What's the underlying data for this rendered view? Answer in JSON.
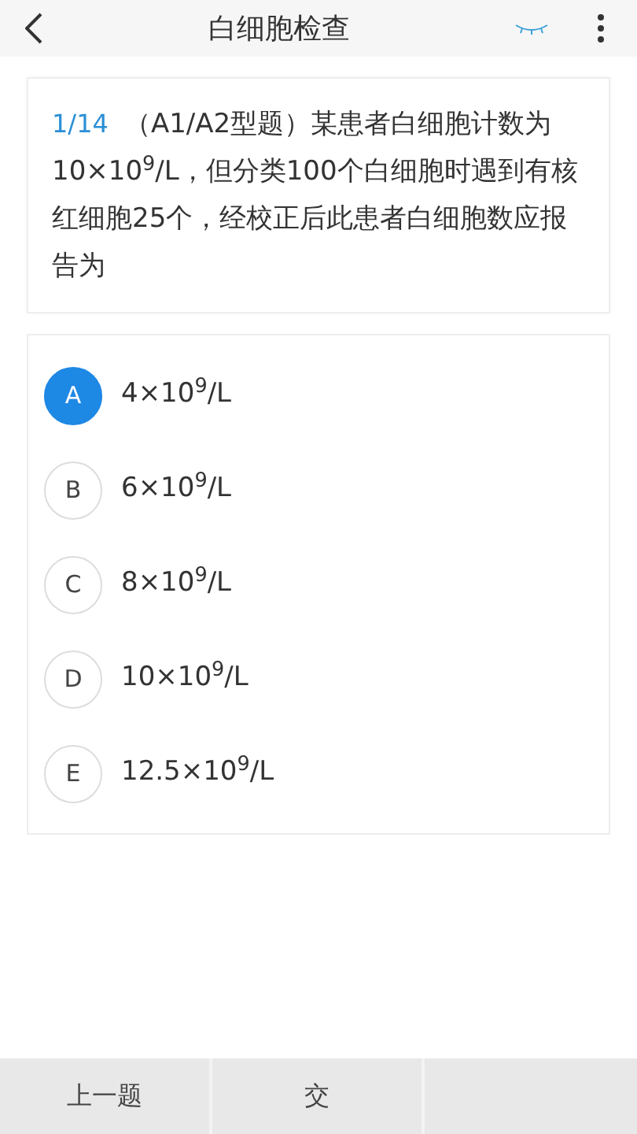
{
  "header": {
    "title": "白细胞检查"
  },
  "question": {
    "number": "1/14",
    "text": "（A1/A2型题）某患者白细胞计数为10×10$^{9}$/L，但分类100个白细胞时遇到有核红细胞25个，经校正后此患者白细胞数应报告为"
  },
  "options": [
    {
      "letter": "A",
      "text": "4×10$^{9}$/L",
      "selected": true
    },
    {
      "letter": "B",
      "text": "6×10$^{9}$/L",
      "selected": false
    },
    {
      "letter": "C",
      "text": "8×10$^{9}$/L",
      "selected": false
    },
    {
      "letter": "D",
      "text": "10×10$^{9}$/L",
      "selected": false
    },
    {
      "letter": "E",
      "text": "12.5×10$^{9}$/L",
      "selected": false
    }
  ],
  "bottom_bar": [
    "上一题",
    "交"
  ]
}
